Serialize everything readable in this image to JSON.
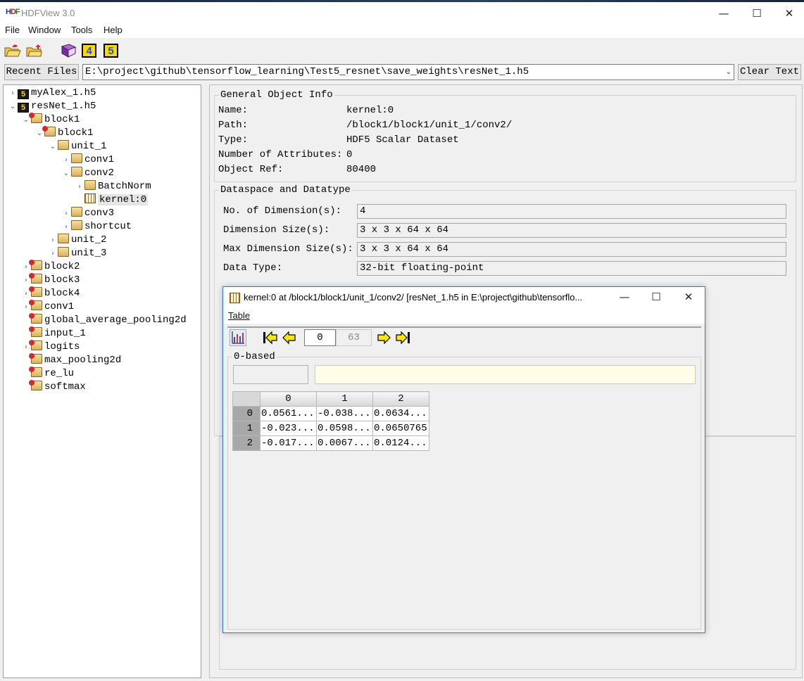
{
  "app": {
    "logo": "HDF",
    "title": "HDFView 3.0"
  },
  "window_controls": {
    "minimize": "—",
    "maximize": "☐",
    "close": "✕"
  },
  "menu": [
    "File",
    "Window",
    "Tools",
    "Help"
  ],
  "toolbar": {
    "icons": [
      "open-file-icon",
      "open-folder-icon",
      "user-guide-icon",
      "hdf4-icon",
      "hdf5-icon"
    ],
    "hdf4_label": "4",
    "hdf5_label": "5"
  },
  "recent": {
    "button_label": "Recent Files",
    "path": "E:\\project\\github\\tensorflow_learning\\Test5_resnet\\save_weights\\resNet_1.h5",
    "clear_label": "Clear Text"
  },
  "tree": [
    {
      "label": "myAlex_1.h5",
      "icon": "h5-file-icon",
      "h5": "5",
      "twisty": "›",
      "level": 0
    },
    {
      "label": "resNet_1.h5",
      "icon": "h5-file-icon",
      "h5": "5",
      "twisty": "⌄",
      "level": 0
    },
    {
      "label": "block1",
      "icon": "group-icon",
      "twisty": "⌄",
      "level": 1
    },
    {
      "label": "block1",
      "icon": "group-icon",
      "twisty": "⌄",
      "level": 2
    },
    {
      "label": "unit_1",
      "icon": "folder-icon",
      "twisty": "⌄",
      "level": 3
    },
    {
      "label": "conv1",
      "icon": "folder-icon",
      "twisty": "›",
      "level": 4
    },
    {
      "label": "conv2",
      "icon": "folder-icon",
      "twisty": "⌄",
      "level": 4
    },
    {
      "label": "BatchNorm",
      "icon": "folder-icon",
      "twisty": "›",
      "level": 5
    },
    {
      "label": "kernel:0",
      "icon": "dataset-icon",
      "twisty": "",
      "level": 5,
      "selected": true
    },
    {
      "label": "conv3",
      "icon": "folder-icon",
      "twisty": "›",
      "level": 4
    },
    {
      "label": "shortcut",
      "icon": "folder-icon",
      "twisty": "›",
      "level": 4
    },
    {
      "label": "unit_2",
      "icon": "folder-icon",
      "twisty": "›",
      "level": 3
    },
    {
      "label": "unit_3",
      "icon": "folder-icon",
      "twisty": "›",
      "level": 3
    },
    {
      "label": "block2",
      "icon": "group-icon",
      "twisty": "›",
      "level": 1
    },
    {
      "label": "block3",
      "icon": "group-icon",
      "twisty": "›",
      "level": 1
    },
    {
      "label": "block4",
      "icon": "group-icon",
      "twisty": "›",
      "level": 1
    },
    {
      "label": "conv1",
      "icon": "group-icon",
      "twisty": "›",
      "level": 1
    },
    {
      "label": "global_average_pooling2d",
      "icon": "group-icon",
      "twisty": "",
      "level": 1
    },
    {
      "label": "input_1",
      "icon": "group-icon",
      "twisty": "",
      "level": 1
    },
    {
      "label": "logits",
      "icon": "group-icon",
      "twisty": "›",
      "level": 1
    },
    {
      "label": "max_pooling2d",
      "icon": "group-icon",
      "twisty": "",
      "level": 1
    },
    {
      "label": "re_lu",
      "icon": "group-icon",
      "twisty": "",
      "level": 1
    },
    {
      "label": "softmax",
      "icon": "group-icon",
      "twisty": "",
      "level": 1
    }
  ],
  "general_info": {
    "legend": "General Object Info",
    "rows": [
      {
        "label": "Name:",
        "value": "kernel:0"
      },
      {
        "label": "Path:",
        "value": "/block1/block1/unit_1/conv2/"
      },
      {
        "label": "Type:",
        "value": "HDF5 Scalar Dataset"
      },
      {
        "label": "Number of Attributes:",
        "value": "0"
      },
      {
        "label": "Object Ref:",
        "value": "80400"
      }
    ]
  },
  "dataspace": {
    "legend": "Dataspace and Datatype",
    "rows": [
      {
        "label": "No. of Dimension(s):",
        "value": "4"
      },
      {
        "label": "Dimension Size(s):",
        "value": "3 x 3 x 64 x 64"
      },
      {
        "label": "Max Dimension Size(s):",
        "value": "3 x 3 x 64 x 64"
      },
      {
        "label": "Data Type:",
        "value": "32-bit floating-point"
      }
    ]
  },
  "dialog": {
    "title": "kernel:0  at  /block1/block1/unit_1/conv2/  [resNet_1.h5  in  E:\\project\\github\\tensorflo...",
    "menu": "Table",
    "page_current": "0",
    "page_total": "63",
    "index_base_label": "0-based",
    "table": {
      "columns": [
        "0",
        "1",
        "2"
      ],
      "rows": [
        {
          "header": "0",
          "cells": [
            "0.0561...",
            "-0.038...",
            "0.0634..."
          ]
        },
        {
          "header": "1",
          "cells": [
            "-0.023...",
            "0.0598...",
            "0.0650765"
          ]
        },
        {
          "header": "2",
          "cells": [
            "-0.017...",
            "0.0067...",
            "0.0124..."
          ]
        }
      ]
    }
  }
}
